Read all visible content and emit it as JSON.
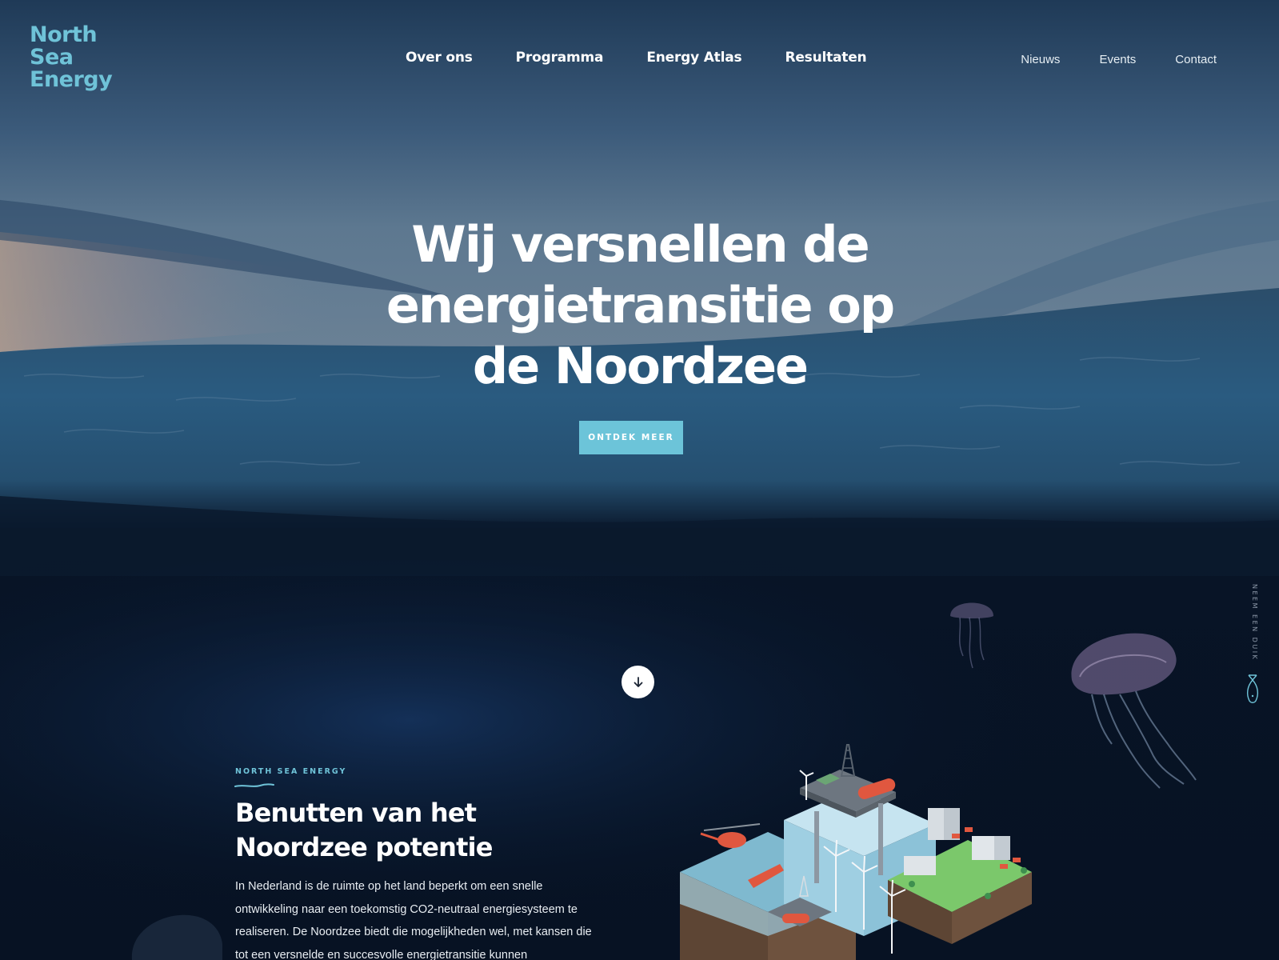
{
  "brand": {
    "logo_line1": "North",
    "logo_line2": "Sea",
    "logo_line3": "Energy",
    "color": "#6fc3d8"
  },
  "nav": {
    "main": [
      {
        "label": "Over ons"
      },
      {
        "label": "Programma"
      },
      {
        "label": "Energy Atlas"
      },
      {
        "label": "Resultaten"
      }
    ],
    "secondary": [
      {
        "label": "Nieuws"
      },
      {
        "label": "Events"
      },
      {
        "label": "Contact"
      }
    ]
  },
  "hero": {
    "title_line1": "Wij versnellen de",
    "title_line2": "energietransitie op",
    "title_line3": "de Noordzee",
    "cta_label": "ONTDEK MEER",
    "cta_color": "#6cc4d9"
  },
  "scroll": {
    "icon": "arrow-down-icon"
  },
  "side": {
    "dive_label": "NEEM EEN DUIK",
    "icon": "fish-icon"
  },
  "section": {
    "eyebrow": "NORTH SEA ENERGY",
    "title_line1": "Benutten van het",
    "title_line2": "Noordzee potentie",
    "body": "In Nederland is de ruimte op het land beperkt om een snelle ontwikkeling naar een toekomstig CO2-neutraal energiesysteem te realiseren. De Noordzee biedt die mogelijkheden wel, met kansen die tot een versnelde en succesvolle energietransitie kunnen"
  },
  "colors": {
    "deep_sea": "#081528",
    "accent": "#6fc3d8"
  }
}
